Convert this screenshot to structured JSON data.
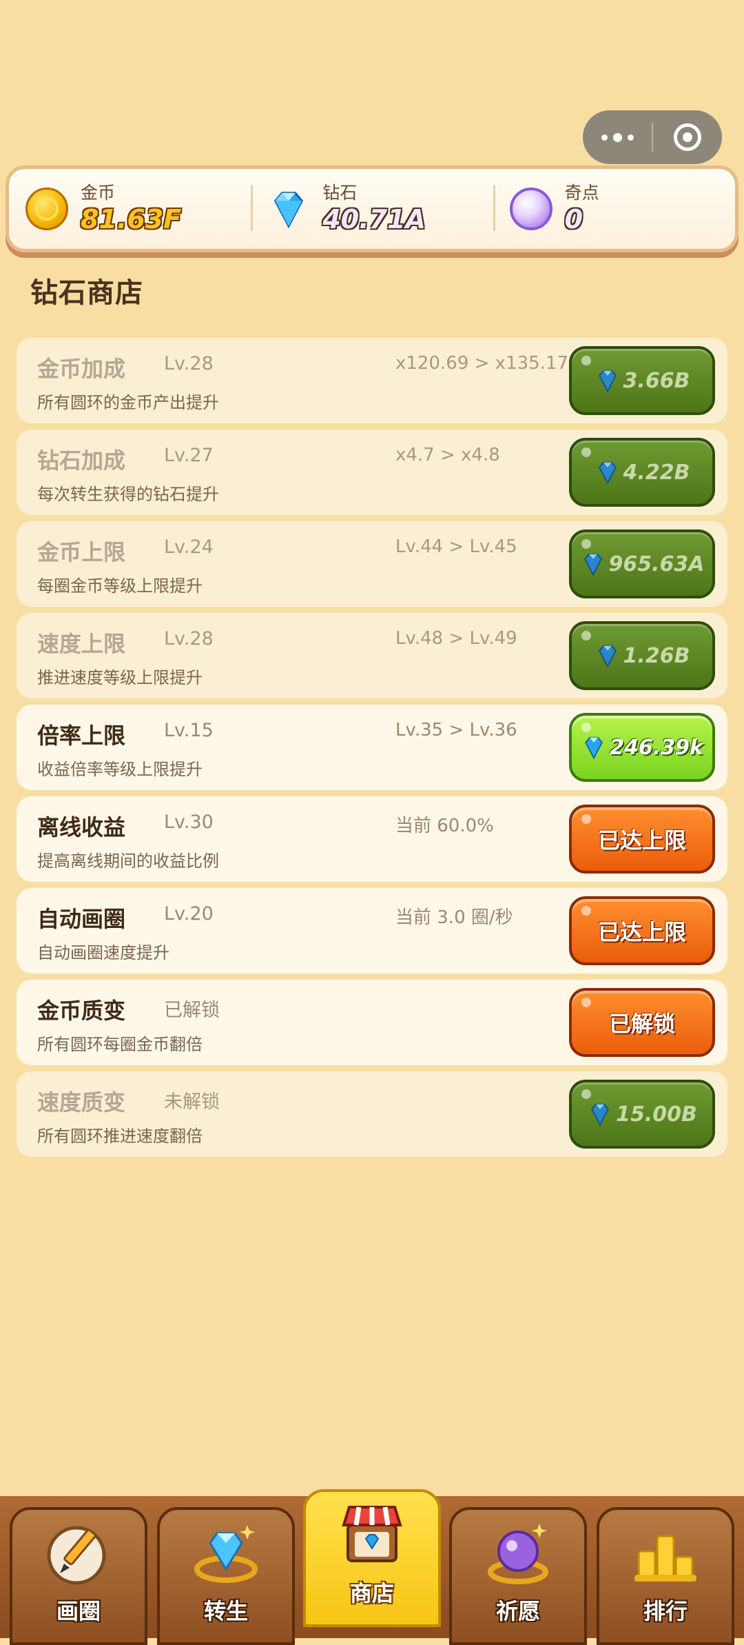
{
  "currencies": {
    "gold": {
      "label": "金币",
      "value": "81.63F",
      "icon": "gold-coin-icon"
    },
    "diamond": {
      "label": "钻石",
      "value": "40.71A",
      "icon": "diamond-icon"
    },
    "odd": {
      "label": "奇点",
      "value": "0",
      "icon": "purple-orb-icon"
    }
  },
  "page": {
    "title": "钻石商店"
  },
  "shop": {
    "items": [
      {
        "name": "金币加成",
        "level": "Lv.28",
        "effect": "x120.69 > x135.17",
        "desc": "所有圆环的金币产出提升",
        "button": "3.66B",
        "state": "locked"
      },
      {
        "name": "钻石加成",
        "level": "Lv.27",
        "effect": "x4.7 > x4.8",
        "desc": "每次转生获得的钻石提升",
        "button": "4.22B",
        "state": "locked"
      },
      {
        "name": "金币上限",
        "level": "Lv.24",
        "effect": "Lv.44 > Lv.45",
        "desc": "每圈金币等级上限提升",
        "button": "965.63A",
        "state": "locked"
      },
      {
        "name": "速度上限",
        "level": "Lv.28",
        "effect": "Lv.48 > Lv.49",
        "desc": "推进速度等级上限提升",
        "button": "1.26B",
        "state": "locked"
      },
      {
        "name": "倍率上限",
        "level": "Lv.15",
        "effect": "Lv.35 > Lv.36",
        "desc": "收益倍率等级上限提升",
        "button": "246.39k",
        "state": "affordable"
      },
      {
        "name": "离线收益",
        "level": "Lv.30",
        "effect": "当前 60.0%",
        "desc": "提高离线期间的收益比例",
        "button": "已达上限",
        "state": "max"
      },
      {
        "name": "自动画圈",
        "level": "Lv.20",
        "effect": "当前 3.0 圈/秒",
        "desc": "自动画圈速度提升",
        "button": "已达上限",
        "state": "max"
      },
      {
        "name": "金币质变",
        "level": "已解锁",
        "effect": "",
        "desc": "所有圆环每圈金币翻倍",
        "button": "已解锁",
        "state": "unlocked"
      },
      {
        "name": "速度质变",
        "level": "未解锁",
        "effect": "",
        "desc": "所有圆环推进速度翻倍",
        "button": "15.00B",
        "state": "locked"
      }
    ]
  },
  "nav": {
    "tabs": [
      {
        "label": "画圈",
        "icon": "pencil-circle-icon"
      },
      {
        "label": "转生",
        "icon": "diamond-ring-icon"
      },
      {
        "label": "商店",
        "icon": "shop-icon",
        "active": true
      },
      {
        "label": "祈愿",
        "icon": "crystal-ball-icon"
      },
      {
        "label": "排行",
        "icon": "podium-icon"
      }
    ]
  },
  "colors": {
    "background": "#f8dea2",
    "green_button": "#4d7618",
    "bright_green_button": "#7ad41e",
    "orange_button": "#ea5d0b",
    "active_tab": "#f7c513"
  }
}
